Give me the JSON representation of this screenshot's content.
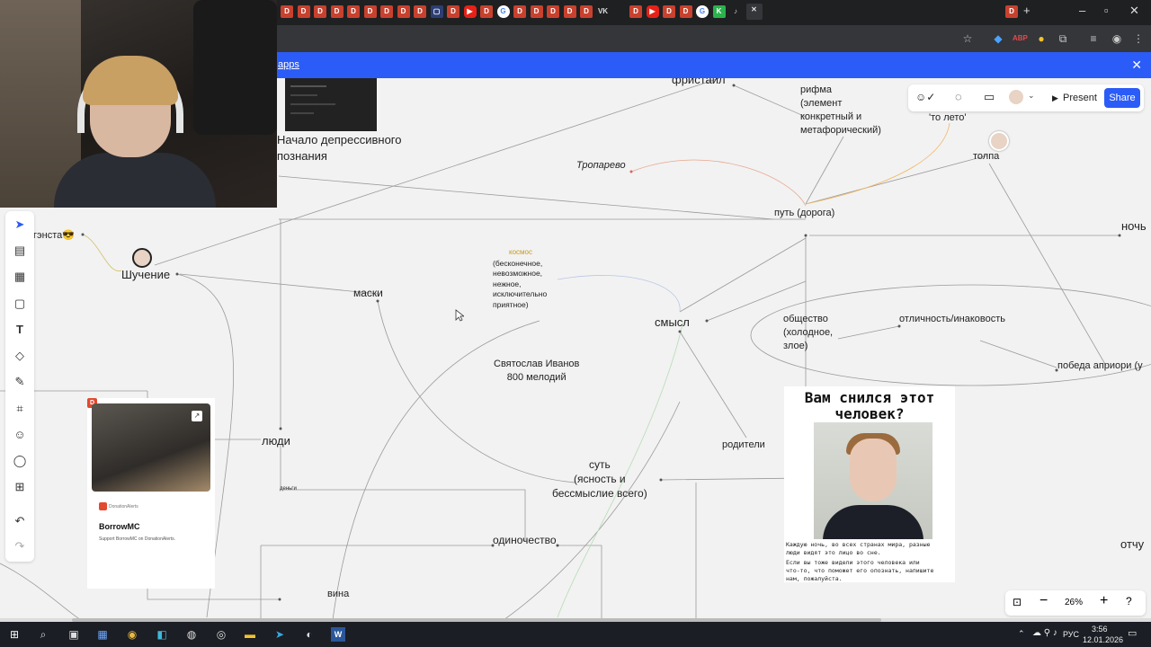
{
  "browser": {
    "banner_link": "apps",
    "tabs": [
      "don",
      "don",
      "don",
      "don",
      "don",
      "don",
      "don",
      "don",
      "don",
      "dark",
      "don",
      "yt",
      "don",
      "g",
      "don",
      "don",
      "don",
      "don",
      "don",
      "vk",
      "don",
      "yt",
      "don",
      "don",
      "g",
      "k",
      "spk",
      "active"
    ]
  },
  "board": {
    "toolbar": {
      "present": "Present",
      "share": "Share",
      "icons": [
        "reactions-icon",
        "comments-icon",
        "video-icon",
        "avatar",
        "chevron-down-icon"
      ]
    },
    "zoom": "26%",
    "nodes": {
      "freestyle": "фристайл",
      "rhyme": "рифма\n(элемент\nконкретный и\nметафорический)",
      "that_summer": "'то лето'",
      "depressive": "Начало депрессивного\nпознания",
      "troparevo": "Тропарево",
      "crowd": "толпа",
      "path": "путь (дорога)",
      "night": "ночь",
      "gangsta": "гэнста😎",
      "joking": "Шучение",
      "masks": "маски",
      "space_title": "космос",
      "space_desc": "(бесконечное,\nневозможное,\nнежное,\nисключительно\nприятное)",
      "meaning": "смысл",
      "society": "общество\n(холодное,\nзлое)",
      "distinction": "отличность/инаковость",
      "victory": "победа априори (у",
      "composer": "Святослав Иванов\n800 мелодий",
      "parents": "родители",
      "people": "люди",
      "money": "деньги",
      "essence": "суть\n(ясность и\nбессмыслие всего)",
      "loneliness": "одиночество",
      "guilt": "вина",
      "despair": "отчу"
    },
    "donation_card": {
      "brand": "DonationAlerts",
      "title": "BorrowMC",
      "subtitle": "Support BorrowMC on DonationAlerts."
    },
    "poster": {
      "heading": "Вам снился этот\nчеловек?",
      "text1": "Каждую ночь, во всех странах мира, разные\nлюди видят это лицо во сне.",
      "text2": "Если вы тоже видели этого человека или\nчто-то, что поможет его опознать, напишите\nнам, пожалуйста."
    }
  },
  "taskbar": {
    "lang": "РУС",
    "time": "3:56",
    "date": "12.01.2026"
  },
  "colors": {
    "accent": "#2b5cf7",
    "canvas": "#f2f2f2",
    "tab_strip": "#1f2022",
    "toolbar": "#35363a",
    "taskbar": "#1b1e24"
  }
}
